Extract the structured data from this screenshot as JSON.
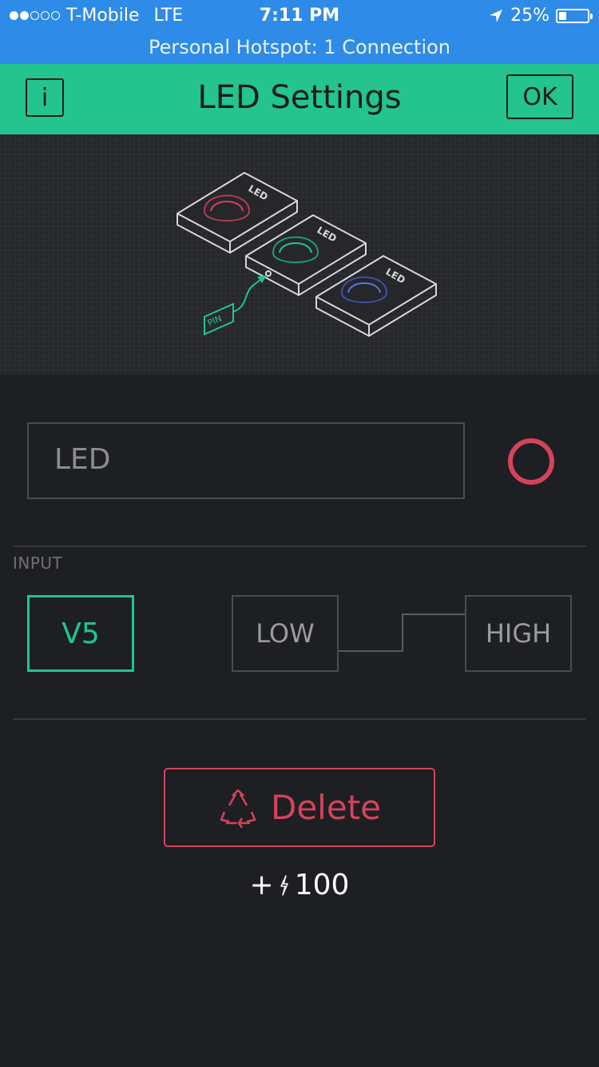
{
  "status_bar": {
    "carrier": "T-Mobile",
    "network": "LTE",
    "time": "7:11 PM",
    "battery_percent": "25%",
    "battery_level": 0.25,
    "signal_bars": 2
  },
  "hotspot_banner": "Personal Hotspot: 1 Connection",
  "header": {
    "title": "LED Settings",
    "info_label": "i",
    "ok_label": "OK"
  },
  "illustration": {
    "led_label": "LED",
    "pin_label": "PIN"
  },
  "name_field": {
    "value": "LED"
  },
  "input_section": {
    "label": "INPUT",
    "pin": "V5",
    "low_label": "LOW",
    "high_label": "HIGH"
  },
  "delete_label": "Delete",
  "energy": {
    "prefix": "+",
    "amount": "100"
  },
  "colors": {
    "accent_green": "#23c48e",
    "accent_red": "#d3435c",
    "status_blue": "#2e8be8",
    "background": "#1e1f23"
  }
}
